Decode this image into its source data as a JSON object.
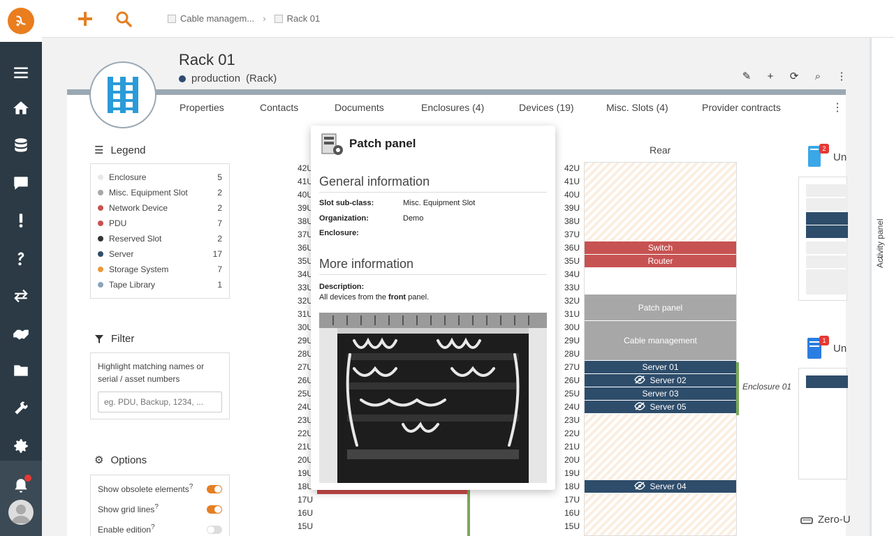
{
  "topbar": {
    "breadcrumb": [
      {
        "label": "Cable managem..."
      },
      {
        "label": "Rack 01"
      }
    ]
  },
  "page": {
    "title": "Rack 01",
    "status": "production",
    "class": "(Rack)"
  },
  "tabs": [
    "Properties",
    "Contacts",
    "Documents",
    "Enclosures (4)",
    "Devices (19)",
    "Misc. Slots (4)",
    "Provider contracts"
  ],
  "legend": {
    "title": "Legend",
    "items": [
      {
        "name": "Enclosure",
        "count": "5",
        "color": "#e8e8e8"
      },
      {
        "name": "Misc. Equipment Slot",
        "count": "2",
        "color": "#a7a7a7"
      },
      {
        "name": "Network Device",
        "count": "2",
        "color": "#c75252"
      },
      {
        "name": "PDU",
        "count": "7",
        "color": "#c75252"
      },
      {
        "name": "Reserved Slot",
        "count": "2",
        "color": "#333333"
      },
      {
        "name": "Server",
        "count": "17",
        "color": "#2e4d6b"
      },
      {
        "name": "Storage System",
        "count": "7",
        "color": "#e89a3c"
      },
      {
        "name": "Tape Library",
        "count": "1",
        "color": "#8aa6bf"
      }
    ]
  },
  "filter": {
    "title": "Filter",
    "hint": "Highlight matching names or serial / asset numbers",
    "placeholder": "eg. PDU, Backup, 1234, ..."
  },
  "options": {
    "title": "Options",
    "items": [
      {
        "label": "Show obsolete elements",
        "sup": "?",
        "state": "on"
      },
      {
        "label": "Show grid lines",
        "sup": "?",
        "state": "on"
      },
      {
        "label": "Enable edition",
        "sup": "?",
        "state": "off"
      }
    ]
  },
  "rack": {
    "rear_title": "Rear",
    "units": [
      "42U",
      "41U",
      "40U",
      "39U",
      "38U",
      "37U",
      "36U",
      "35U",
      "34U",
      "33U",
      "32U",
      "31U",
      "30U",
      "29U",
      "28U",
      "27U",
      "26U",
      "25U",
      "24U",
      "23U",
      "22U",
      "21U",
      "20U",
      "19U",
      "18U",
      "17U",
      "16U",
      "15U"
    ],
    "devices": [
      {
        "label": "Switch",
        "top_u": 36,
        "height_u": 1,
        "kind": "red",
        "hidden": false
      },
      {
        "label": "Router",
        "top_u": 35,
        "height_u": 1,
        "kind": "red",
        "hidden": false
      },
      {
        "label": "Patch panel",
        "top_u": 32,
        "height_u": 2,
        "kind": "gray",
        "hidden": false
      },
      {
        "label": "Cable management",
        "top_u": 30,
        "height_u": 3,
        "kind": "gray",
        "hidden": false
      },
      {
        "label": "Server 01",
        "top_u": 27,
        "height_u": 1,
        "kind": "blue",
        "hidden": false
      },
      {
        "label": "Server 02",
        "top_u": 26,
        "height_u": 1,
        "kind": "blue",
        "hidden": true
      },
      {
        "label": "Server 03",
        "top_u": 25,
        "height_u": 1,
        "kind": "blue",
        "hidden": false
      },
      {
        "label": "Server 05",
        "top_u": 24,
        "height_u": 1,
        "kind": "blue",
        "hidden": true
      },
      {
        "label": "Server 04",
        "top_u": 18,
        "height_u": 1,
        "kind": "blue",
        "hidden": true
      }
    ],
    "enclosure_label": "Enclosure 01"
  },
  "right_panel": {
    "item1_label": "Un",
    "item1_badge": "2",
    "item2_label": "Un",
    "item2_badge": "1",
    "item3_label": "Zero-U"
  },
  "popover": {
    "title": "Patch panel",
    "general_heading": "General information",
    "fields": [
      {
        "key": "Slot sub-class:",
        "value": "Misc. Equipment Slot"
      },
      {
        "key": "Organization:",
        "value": "Demo"
      },
      {
        "key": "Enclosure:",
        "value": ""
      }
    ],
    "more_heading": "More information",
    "description_label": "Description:",
    "description_pre": "All devices from the ",
    "description_bold": "front",
    "description_post": " panel."
  },
  "activity_panel": {
    "label": "Activity panel"
  },
  "colors": {
    "accent": "#ea7d1e",
    "nav_bg": "#2b3a45",
    "server": "#2e4d6b",
    "network": "#c75252"
  }
}
